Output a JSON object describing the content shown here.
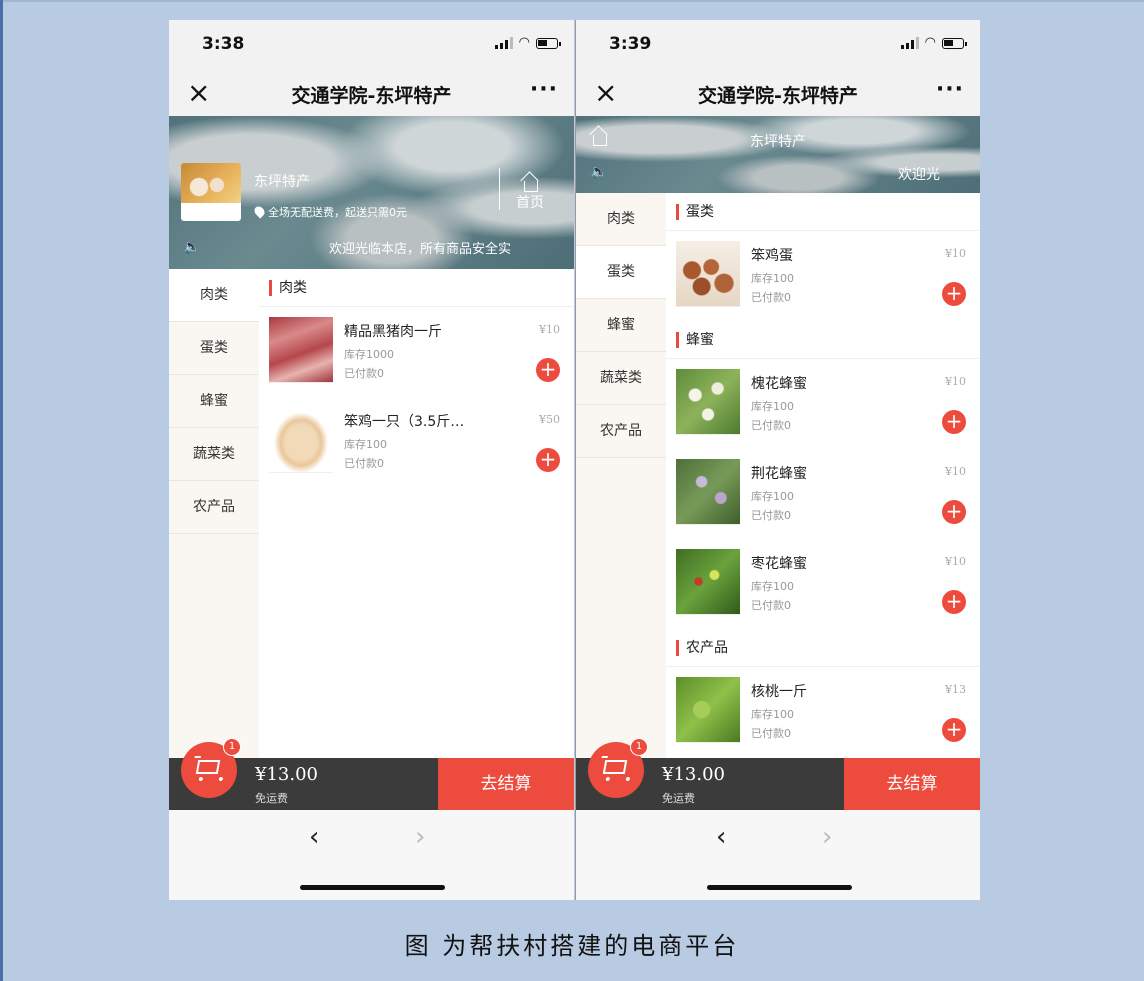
{
  "caption": "图  为帮扶村搭建的电商平台",
  "phone1": {
    "time": "3:38",
    "title": "交通学院-东坪特产",
    "close_icon": "×",
    "more_icon": "···",
    "shop_name": "东坪特产",
    "shop_note": "全场无配送费，起送只需0元",
    "home_label": "首页",
    "speaker_icon": "🔈",
    "marquee": "欢迎光临本店，所有商品安全实",
    "sidebar": [
      "肉类",
      "蛋类",
      "蜂蜜",
      "蔬菜类",
      "农产品"
    ],
    "section": "肉类",
    "products": [
      {
        "name": "精品黑猪肉一斤",
        "price": "¥10",
        "stock": "库存1000",
        "paid": "已付款0"
      },
      {
        "name": "笨鸡一只（3.5斤…",
        "price": "¥50",
        "stock": "库存100",
        "paid": "已付款0"
      }
    ],
    "cart_count": "1",
    "total": "¥13.00",
    "shipping": "免运费",
    "checkout": "去结算",
    "back_icon": "‹",
    "forward_icon": "›"
  },
  "phone2": {
    "time": "3:39",
    "title": "交通学院-东坪特产",
    "close_icon": "×",
    "more_icon": "···",
    "banner_title": "东坪特产",
    "speaker_icon": "🔈",
    "welcome": "欢迎光",
    "sidebar": [
      "肉类",
      "蛋类",
      "蜂蜜",
      "蔬菜类",
      "农产品"
    ],
    "sections": [
      {
        "title": "蛋类",
        "products": [
          {
            "name": "笨鸡蛋",
            "price": "¥10",
            "stock": "库存100",
            "paid": "已付款0"
          }
        ]
      },
      {
        "title": "蜂蜜",
        "products": [
          {
            "name": "槐花蜂蜜",
            "price": "¥10",
            "stock": "库存100",
            "paid": "已付款0"
          },
          {
            "name": "荆花蜂蜜",
            "price": "¥10",
            "stock": "库存100",
            "paid": "已付款0"
          },
          {
            "name": "枣花蜂蜜",
            "price": "¥10",
            "stock": "库存100",
            "paid": "已付款0"
          }
        ]
      },
      {
        "title": "农产品",
        "products": [
          {
            "name": "核桃一斤",
            "price": "¥13",
            "stock": "库存100",
            "paid": "已付款0"
          }
        ]
      }
    ],
    "cart_count": "1",
    "total": "¥13.00",
    "shipping": "免运费",
    "checkout": "去结算",
    "back_icon": "‹",
    "forward_icon": "›"
  },
  "add_icon": "+",
  "colors": {
    "accent": "#ec4b3e",
    "bottom_bar": "#3b3b3b",
    "sidebar_bg": "#faf7f2"
  }
}
